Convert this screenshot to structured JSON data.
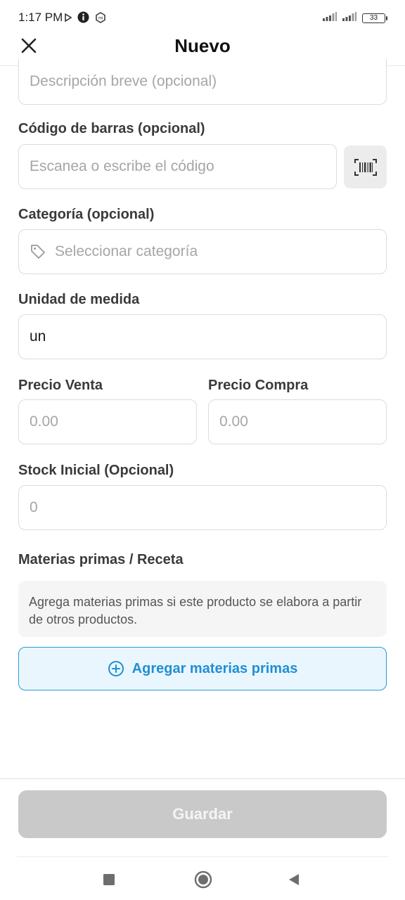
{
  "status_bar": {
    "time": "1:17 PM",
    "battery": "33",
    "icons": [
      "play-indicator-icon",
      "info-icon",
      "mi-icon",
      "signal-icon",
      "signal-icon",
      "battery-icon"
    ]
  },
  "header": {
    "title": "Nuevo",
    "close_icon": "close-icon"
  },
  "form": {
    "description": {
      "placeholder": "Descripción breve (opcional)"
    },
    "barcode": {
      "label": "Código de barras (opcional)",
      "placeholder": "Escanea o escribe el código",
      "scan_icon": "barcode-scan-icon"
    },
    "category": {
      "label": "Categoría (opcional)",
      "placeholder": "Seleccionar categoría",
      "icon": "tag-icon"
    },
    "unit": {
      "label": "Unidad de medida",
      "value": "un"
    },
    "sale_price": {
      "label": "Precio Venta",
      "placeholder": "0.00"
    },
    "purchase_price": {
      "label": "Precio Compra",
      "placeholder": "0.00"
    },
    "initial_stock": {
      "label": "Stock Inicial (Opcional)",
      "placeholder": "0"
    },
    "raw_materials": {
      "label": "Materias primas / Receta",
      "info": "Agrega materias primas si este producto se elabora a partir de otros productos.",
      "add_button": "Agregar materias primas",
      "add_icon": "plus-circle-icon"
    }
  },
  "footer": {
    "save_button": "Guardar"
  },
  "colors": {
    "accent": "#1f8fd4",
    "accent_bg": "#eaf6fd",
    "disabled_button": "#c9c9c9",
    "border": "#dcdcdc",
    "placeholder": "#a6a6a6"
  },
  "nav_bar": {
    "buttons": [
      "recent-apps-icon",
      "home-icon",
      "back-icon"
    ]
  }
}
